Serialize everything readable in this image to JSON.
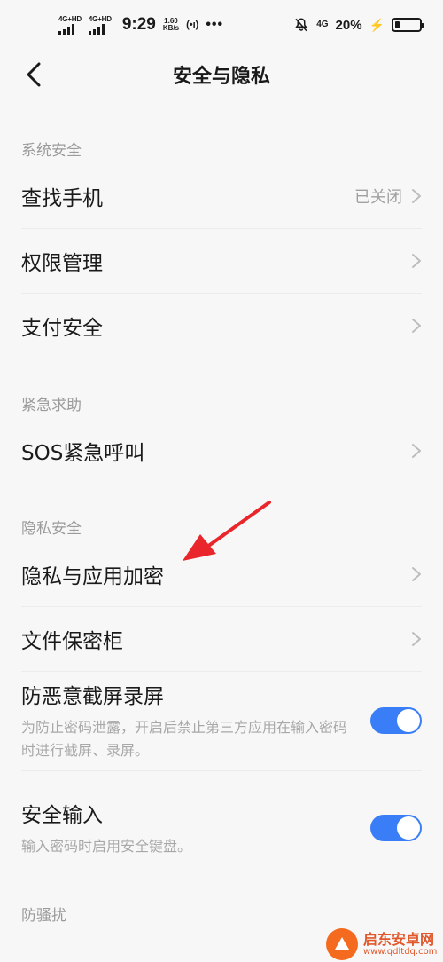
{
  "status_bar": {
    "sim1_net": "4G+HD",
    "sim2_net": "4G+HD",
    "time": "9:29",
    "speed_value": "1.60",
    "speed_unit": "KB/s",
    "hotspot": "(•ı)",
    "more": "•••",
    "net_type": "4G",
    "battery_percent": "20%",
    "battery_level": 0.2,
    "icons": [
      "signal-icon",
      "hotspot-icon",
      "mute-icon",
      "charging-icon",
      "battery-icon"
    ]
  },
  "header": {
    "title": "安全与隐私",
    "back_icon": "chevron-left-icon"
  },
  "sections": {
    "system": {
      "label": "系统安全",
      "items": [
        {
          "label": "查找手机",
          "value": "已关闭"
        },
        {
          "label": "权限管理"
        },
        {
          "label": "支付安全"
        }
      ]
    },
    "emergency": {
      "label": "紧急求助",
      "items": [
        {
          "label": "SOS紧急呼叫"
        }
      ]
    },
    "privacy": {
      "label": "隐私安全",
      "items": [
        {
          "label": "隐私与应用加密"
        },
        {
          "label": "文件保密柜"
        }
      ],
      "toggles": [
        {
          "title": "防恶意截屏录屏",
          "desc": "为防止密码泄露，开启后禁止第三方应用在输入密码时进行截屏、录屏。",
          "on": true
        },
        {
          "title": "安全输入",
          "desc": "输入密码时启用安全键盘。",
          "on": true
        }
      ]
    },
    "harassment": {
      "label": "防骚扰"
    }
  },
  "colors": {
    "accent": "#3a7ef7",
    "annotation": "#e8262b",
    "muted_text": "#9b9b9b"
  },
  "watermark": {
    "name": "启东安卓网",
    "url": "www.qdltdq.com"
  }
}
